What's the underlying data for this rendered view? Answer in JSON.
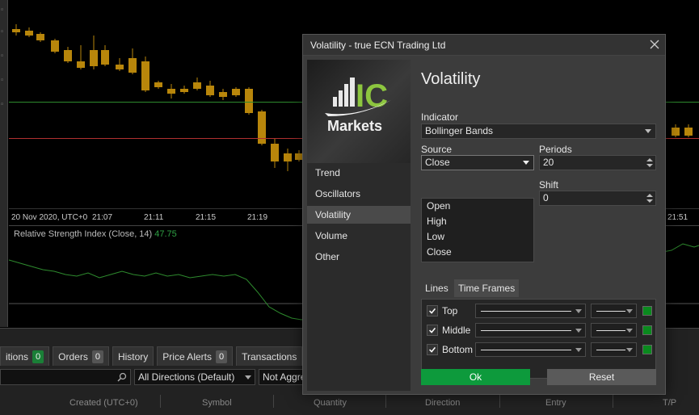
{
  "chart": {
    "x_axis_labels": [
      "20 Nov 2020, UTC+0",
      "21:07",
      "21:11",
      "21:15",
      "21:19",
      "21:51"
    ],
    "rsi_title": "Relative Strength Index (Close, 14)",
    "rsi_value": "47.75",
    "colors": {
      "candle": "#b8860b",
      "support_line": "#2e8b2e",
      "resistance_line": "#b03030",
      "rsi_line": "#2e8b2e"
    }
  },
  "trade_panel": {
    "tabs": [
      {
        "label": "itions",
        "count": "0"
      },
      {
        "label": "Orders",
        "count": "0"
      },
      {
        "label": "History",
        "count": ""
      },
      {
        "label": "Price Alerts",
        "count": "0"
      },
      {
        "label": "Transactions",
        "count": ""
      }
    ],
    "direction_filter": "All Directions (Default)",
    "aggregation_filter": "Not Aggre",
    "columns": [
      "Created (UTC+0)",
      "Symbol",
      "Quantity",
      "Direction",
      "Entry",
      "T/P"
    ]
  },
  "dialog": {
    "title": "Volatility - true ECN Trading Ltd",
    "logo": {
      "letters": "IC",
      "name": "Markets"
    },
    "nav": [
      "Trend",
      "Oscillators",
      "Volatility",
      "Volume",
      "Other"
    ],
    "active_nav": "Volatility",
    "heading": "Volatility",
    "indicator_label": "Indicator",
    "indicator_value": "Bollinger Bands",
    "source_label": "Source",
    "source_value": "Close",
    "source_options": [
      "Open",
      "High",
      "Low",
      "Close"
    ],
    "periods_label": "Periods",
    "periods_value": "20",
    "shift_label": "Shift",
    "shift_value": "0",
    "subtabs": [
      "Lines",
      "Time Frames"
    ],
    "lines": [
      {
        "label": "Top",
        "checked": true,
        "color": "#0a8a1e"
      },
      {
        "label": "Middle",
        "checked": true,
        "color": "#0a8a1e"
      },
      {
        "label": "Bottom",
        "checked": true,
        "color": "#0a8a1e"
      }
    ],
    "ok_label": "Ok",
    "reset_label": "Reset"
  }
}
